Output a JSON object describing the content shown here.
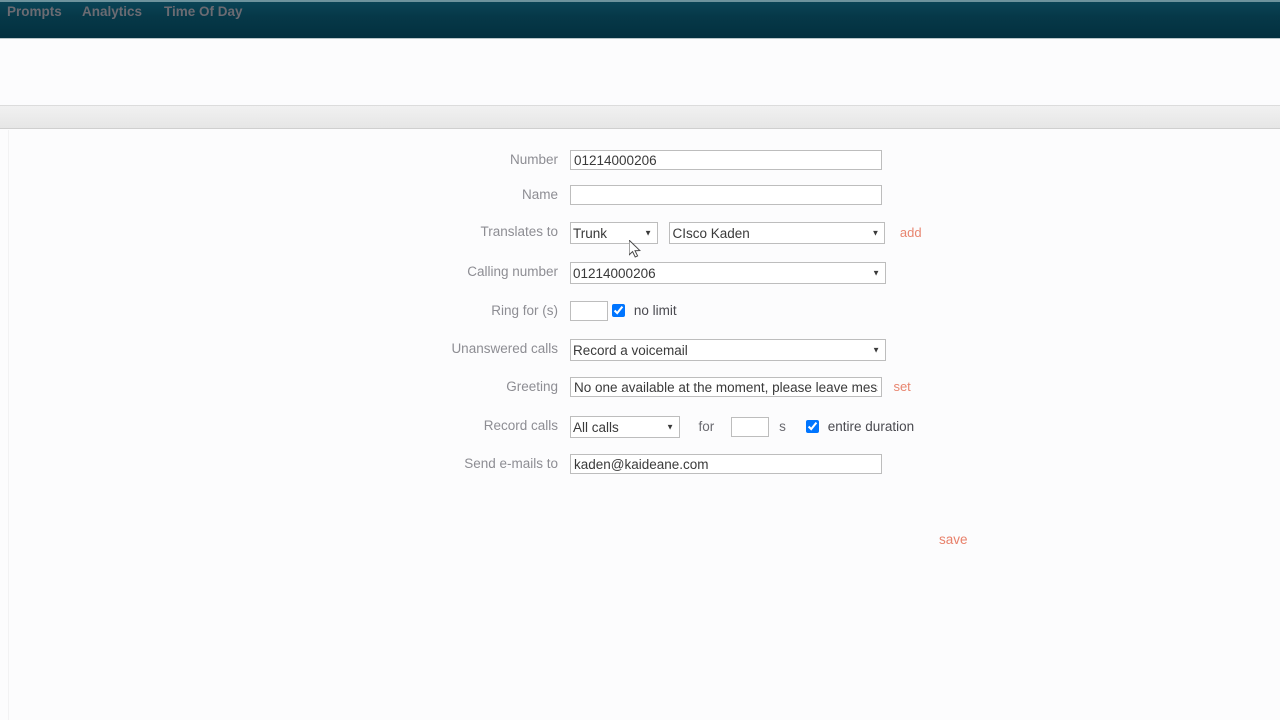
{
  "brand": {
    "name": ""
  },
  "nav": {
    "items": [
      {
        "id": "prompts",
        "label": "Prompts"
      },
      {
        "id": "analytics",
        "label": "Analytics"
      },
      {
        "id": "tod",
        "label": "Time Of Day"
      }
    ]
  },
  "watermarks": {
    "top": "",
    "main": ""
  },
  "form": {
    "number": {
      "label": "Number",
      "value": "01214000206",
      "placeholder": ""
    },
    "name": {
      "label": "Name",
      "value": "",
      "placeholder": ""
    },
    "translates_to": {
      "label": "Translates to",
      "kind_value": "Trunk",
      "kind_options": [
        "Trunk"
      ],
      "target_value": "CIsco Kaden",
      "target_options": [
        "CIsco Kaden"
      ],
      "add_label": "add"
    },
    "calling_number": {
      "label": "Calling number",
      "value": "01214000206",
      "options": [
        "01214000206"
      ]
    },
    "ring_for": {
      "label": "Ring for (s)",
      "value": "",
      "placeholder": "",
      "no_limit_label": "no limit",
      "no_limit_checked": true
    },
    "unanswered_calls": {
      "label": "Unanswered calls",
      "value": "Record a voicemail",
      "options": [
        "Record a voicemail"
      ]
    },
    "greeting": {
      "label": "Greeting",
      "value": "No one available at the moment, please leave message after the tone",
      "visible_text": "No one available at the moment, please leave mess",
      "set_label": "set"
    },
    "record_calls": {
      "label": "Record calls",
      "value": "All calls",
      "options": [
        "All calls"
      ],
      "for_label": "for",
      "duration_value": "",
      "seconds_unit": "s",
      "entire_duration_label": "entire duration",
      "entire_duration_checked": true
    },
    "send_emails_to": {
      "label": "Send e-mails to",
      "value": "kaden@kaideane.com",
      "placeholder": ""
    },
    "save_label": "save"
  },
  "colors": {
    "header_bar": "#063848",
    "accent_link": "#e8806a",
    "label_text": "#8d8d93",
    "page_background": "#fcfcfd"
  }
}
